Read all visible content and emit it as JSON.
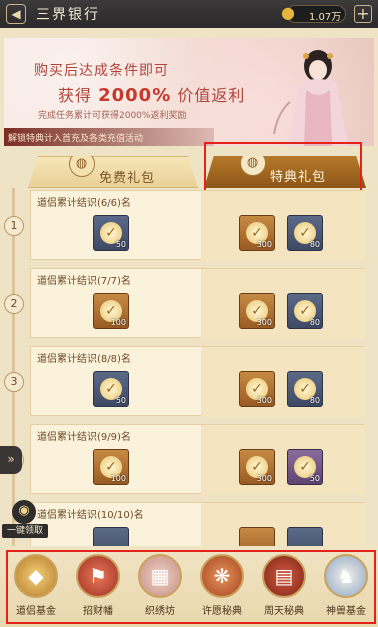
{
  "header": {
    "title": "三界银行",
    "currency_amount": "1.07万"
  },
  "banner": {
    "line1": "购买后达成条件即可",
    "line2_prefix": "获得",
    "line2_value": "2000%",
    "line2_suffix": "价值返利",
    "line3": "完成任务累计可获得2000%返利奖励",
    "bottom": "解锁特典计入首充及各类充值活动"
  },
  "tabs": {
    "free": "免费礼包",
    "special": "特典礼包"
  },
  "rows": [
    {
      "step": "1",
      "title": "道侣累计结识(6/6)名",
      "free_items": [
        {
          "qty": "50"
        }
      ],
      "special_items": [
        {
          "qty": "300"
        },
        {
          "qty": "80"
        }
      ]
    },
    {
      "step": "2",
      "title": "道侣累计结识(7/7)名",
      "free_items": [
        {
          "qty": "100"
        }
      ],
      "special_items": [
        {
          "qty": "300"
        },
        {
          "qty": "80"
        }
      ]
    },
    {
      "step": "3",
      "title": "道侣累计结识(8/8)名",
      "free_items": [
        {
          "qty": "50"
        }
      ],
      "special_items": [
        {
          "qty": "300"
        },
        {
          "qty": "80"
        }
      ]
    },
    {
      "step": "4",
      "title": "道侣累计结识(9/9)名",
      "free_items": [
        {
          "qty": "100"
        }
      ],
      "special_items": [
        {
          "qty": "300"
        },
        {
          "qty": "50"
        }
      ]
    },
    {
      "step": "5",
      "title": "道侣累计结识(10/10)名",
      "free_items": [],
      "special_items": []
    }
  ],
  "claim_all": "一键领取",
  "bottom_nav": [
    {
      "label": "道侣基金",
      "icon": "gold-ingot-icon"
    },
    {
      "label": "招财幡",
      "icon": "banner-flag-icon"
    },
    {
      "label": "织绣坊",
      "icon": "embroidery-icon"
    },
    {
      "label": "许愿秘典",
      "icon": "wish-book-icon"
    },
    {
      "label": "周天秘典",
      "icon": "celestial-book-icon"
    },
    {
      "label": "神兽基金",
      "icon": "divine-beast-icon"
    }
  ]
}
